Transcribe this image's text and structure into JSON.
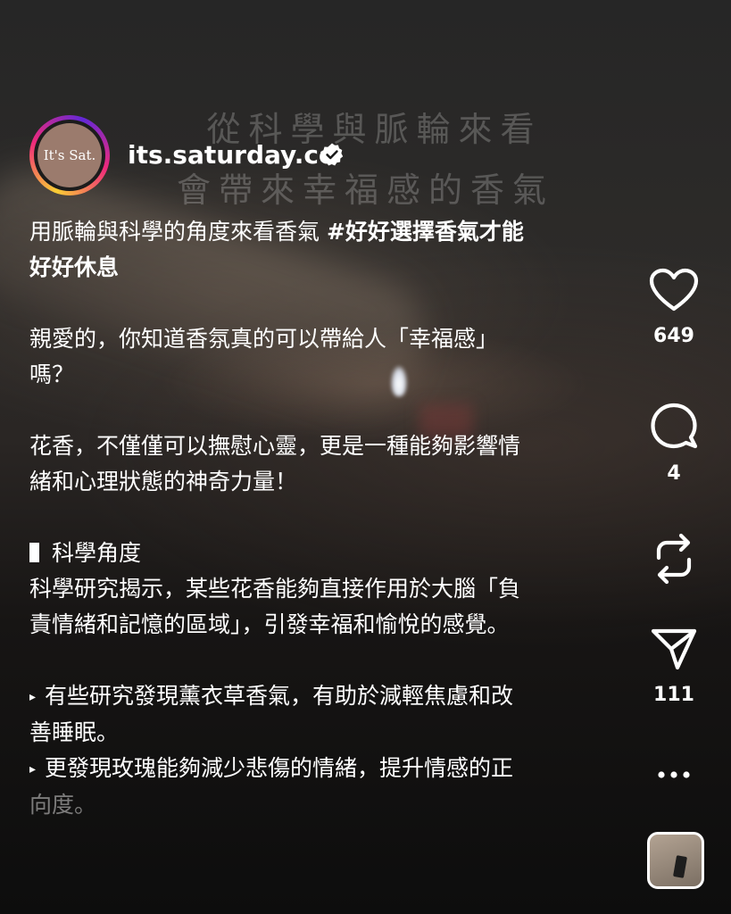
{
  "video_overlay": {
    "line_1": "從科學與脈輪來看",
    "line_2": "會帶來幸福感的香氣"
  },
  "author": {
    "avatar_text": "It's Sat.",
    "username": "its.saturday.co",
    "verified": true
  },
  "caption": {
    "headline_plain": "用脈輪與科學的角度來看香氣 ",
    "headline_hashtag": "#好好選擇香氣才能",
    "headline_bold_cont": "好好休息",
    "para_1_line_1": "親愛的，你知道香氛真的可以帶給人「幸福感」",
    "para_1_line_2": "嗎？",
    "para_2_line_1": "花香，不僅僅可以撫慰心靈，更是一種能夠影響情",
    "para_2_line_2": "緒和心理狀態的神奇力量！",
    "section_heading": "科學角度",
    "section_line_1": "科學研究揭示，某些花香能夠直接作用於大腦「負",
    "section_line_2": "責情緒和記憶的區域」，引發幸福和愉悅的感覺。",
    "bullet_marker": "▸",
    "bullet_1_line_1": "有些研究發現薰衣草香氣，有助於減輕焦慮和改",
    "bullet_1_line_2": "善睡眠。",
    "bullet_2_line_1": "更發現玫瑰能夠減少悲傷的情緒，提升情感的正",
    "bullet_2_line_2": "向度。"
  },
  "actions": {
    "like": {
      "icon": "heart-icon",
      "count": "649"
    },
    "comment": {
      "icon": "comment-icon",
      "count": "4"
    },
    "repost": {
      "icon": "repost-icon"
    },
    "share": {
      "icon": "paper-plane-icon",
      "count": "111"
    },
    "more": {
      "icon": "more-horizontal-icon"
    }
  },
  "colors": {
    "text": "#ffffff",
    "avatar_bg": "#9b7b6d",
    "story_ring": [
      "#f9ce34",
      "#ee2a7b",
      "#6228d7"
    ]
  }
}
